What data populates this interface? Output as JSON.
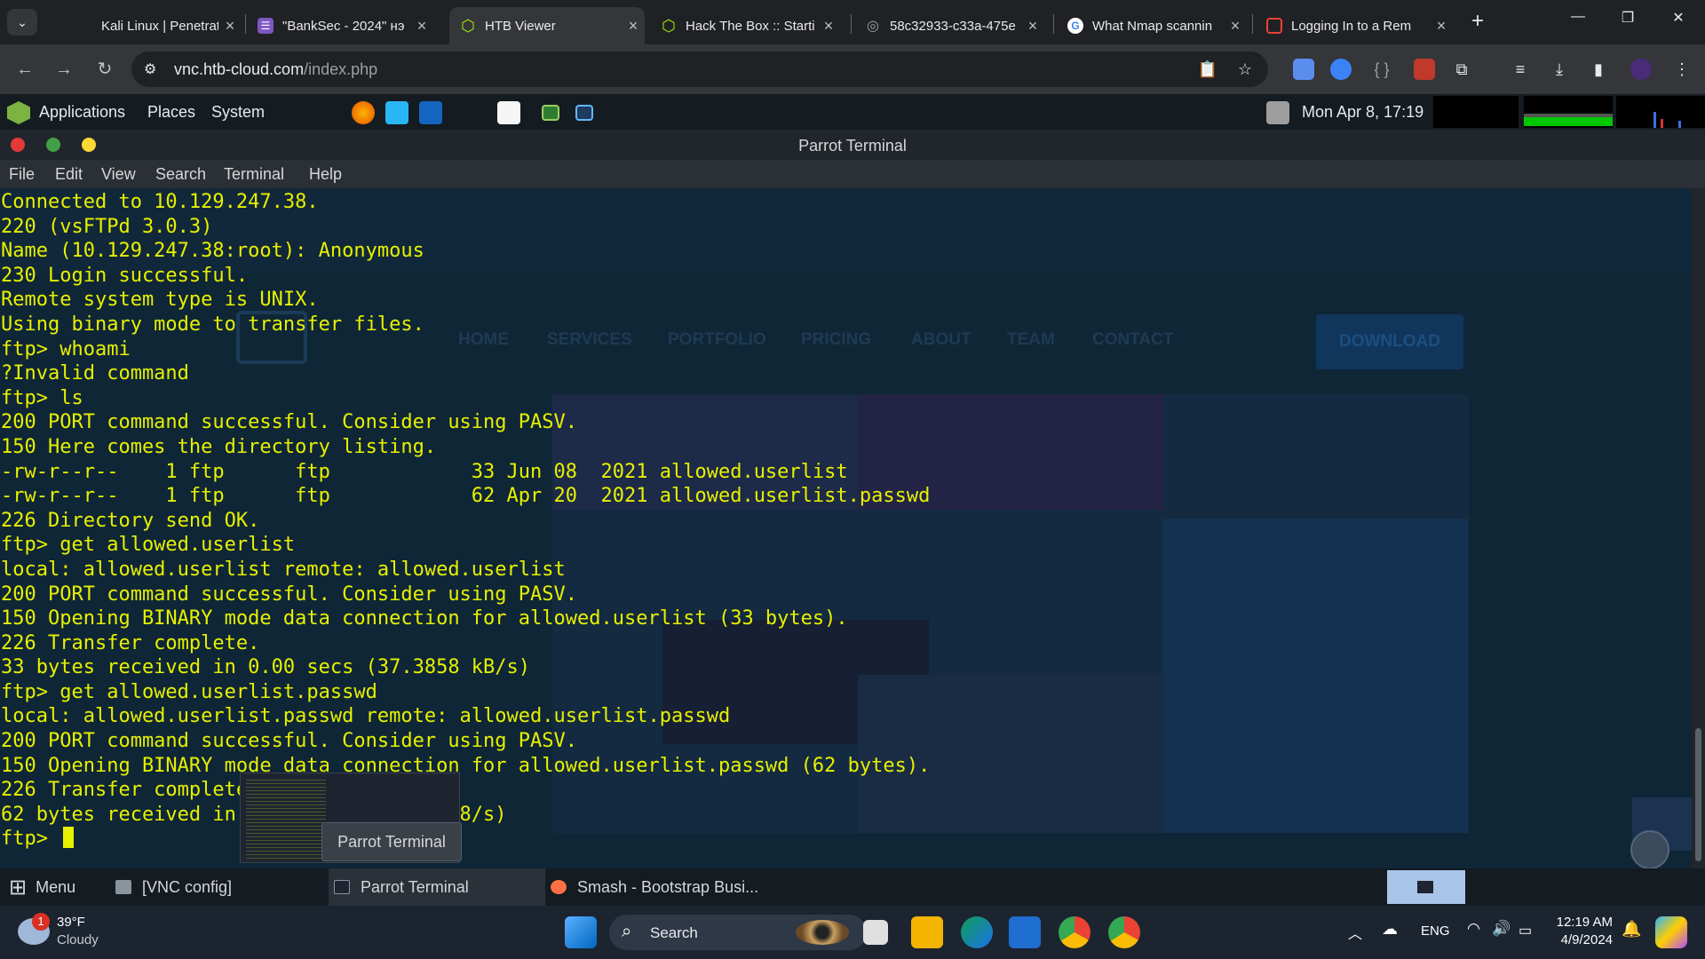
{
  "browser": {
    "tabs": [
      {
        "label": "Kali Linux | Penetratio",
        "favicon_color": "#202124"
      },
      {
        "label": "\"BankSec - 2024\" нэ",
        "favicon_color": "#7e57c2"
      },
      {
        "label": "HTB Viewer",
        "favicon_color": "#9fef00"
      },
      {
        "label": "Hack The Box :: Starti",
        "favicon_color": "#9fef00"
      },
      {
        "label": "58c32933-c33a-475e",
        "favicon_color": "#5f6368"
      },
      {
        "label": "What Nmap scannin",
        "favicon_color": "#ffffff"
      },
      {
        "label": "Logging In to a Rem",
        "favicon_color": "#ea4335"
      }
    ],
    "active_tab_index": 2,
    "url_host": "vnc.htb-cloud.com",
    "url_path": "/index.php"
  },
  "parrot_panel": {
    "menus": [
      "Applications",
      "Places",
      "System"
    ],
    "clock": "Mon Apr  8, 17:19"
  },
  "terminal": {
    "title": "Parrot Terminal",
    "menu": [
      "File",
      "Edit",
      "View",
      "Search",
      "Terminal",
      "Help"
    ],
    "lines": [
      "Connected to 10.129.247.38.",
      "220 (vsFTPd 3.0.3)",
      "Name (10.129.247.38:root): Anonymous",
      "230 Login successful.",
      "Remote system type is UNIX.",
      "Using binary mode to transfer files.",
      "ftp> whoami",
      "?Invalid command",
      "ftp> ls",
      "200 PORT command successful. Consider using PASV.",
      "150 Here comes the directory listing.",
      "-rw-r--r--    1 ftp      ftp            33 Jun 08  2021 allowed.userlist",
      "-rw-r--r--    1 ftp      ftp            62 Apr 20  2021 allowed.userlist.passwd",
      "226 Directory send OK.",
      "ftp> get allowed.userlist",
      "local: allowed.userlist remote: allowed.userlist",
      "200 PORT command successful. Consider using PASV.",
      "150 Opening BINARY mode data connection for allowed.userlist (33 bytes).",
      "226 Transfer complete.",
      "33 bytes received in 0.00 secs (37.3858 kB/s)",
      "ftp> get allowed.userlist.passwd",
      "local: allowed.userlist.passwd remote: allowed.userlist.passwd",
      "200 PORT command successful. Consider using PASV.",
      "150 Opening BINARY mode data connection for allowed.userlist.passwd (62 bytes).",
      "226 Transfer complete",
      "62 bytes received in 0                 8/s)"
    ],
    "prompt": "ftp> ",
    "text_color": "#e6f000",
    "background_color": "#0f2637"
  },
  "background_site": {
    "nav": [
      "HOME",
      "SERVICES",
      "PORTFOLIO",
      "PRICING",
      "ABOUT",
      "TEAM",
      "CONTACT"
    ],
    "download_label": "DOWNLOAD"
  },
  "tooltip": {
    "label": "Parrot Terminal"
  },
  "parrot_taskbar": {
    "menu_label": "Menu",
    "items": [
      "[VNC config]",
      "Parrot Terminal",
      "Smash - Bootstrap Busi..."
    ]
  },
  "windows_taskbar": {
    "weather_temp": "39°F",
    "weather_desc": "Cloudy",
    "weather_badge": "1",
    "search_placeholder": "Search",
    "lang": "ENG",
    "time": "12:19 AM",
    "date": "4/9/2024"
  }
}
